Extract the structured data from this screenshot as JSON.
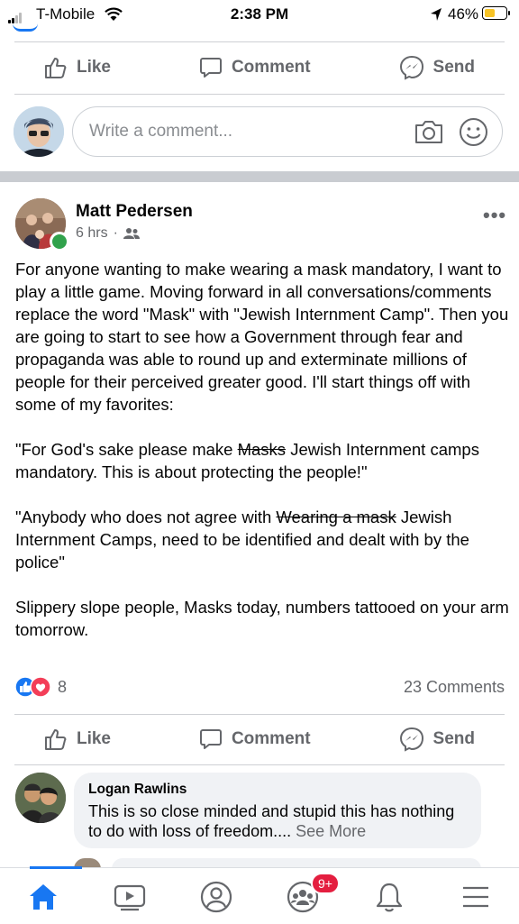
{
  "status_bar": {
    "carrier": "T-Mobile",
    "time": "2:38 PM",
    "battery": "46%"
  },
  "top_actions": {
    "like": "Like",
    "comment": "Comment",
    "send": "Send"
  },
  "comment_box": {
    "placeholder": "Write a comment..."
  },
  "post": {
    "author": "Matt Pedersen",
    "time": "6 hrs",
    "body": {
      "p1": "For anyone wanting to make wearing a mask mandatory, I want to play a little game.  Moving forward in all conversations/comments replace the word \"Mask\" with \"Jewish Internment Camp\".  Then you are going to start to see how a Government through fear and propaganda was able to round up and exterminate millions of people for their perceived greater good.  I'll start things off with some of my favorites:",
      "q1_before": "\"For God's sake please make ",
      "q1_strike": "Masks",
      "q1_after": " Jewish Internment camps mandatory.  This is about protecting the people!\"",
      "q2_before": "\"Anybody who does not agree with ",
      "q2_strike": "Wearing a mask",
      "q2_after": " Jewish Internment Camps, need to be identified and dealt with by the police\"",
      "p4": "Slippery slope people, Masks today, numbers tattooed on your arm tomorrow."
    },
    "reaction_count": "8",
    "comments_count": "23 Comments",
    "actions": {
      "like": "Like",
      "comment": "Comment",
      "send": "Send"
    }
  },
  "comment": {
    "name": "Logan Rawlins",
    "text": "This is so close minded and stupid this has nothing to do with loss of freedom....",
    "see_more": "See More"
  },
  "bottom_nav": {
    "groups_badge": "9+"
  },
  "colors": {
    "accent": "#1877f2",
    "love": "#f33e58",
    "badge": "#e41e3f"
  }
}
